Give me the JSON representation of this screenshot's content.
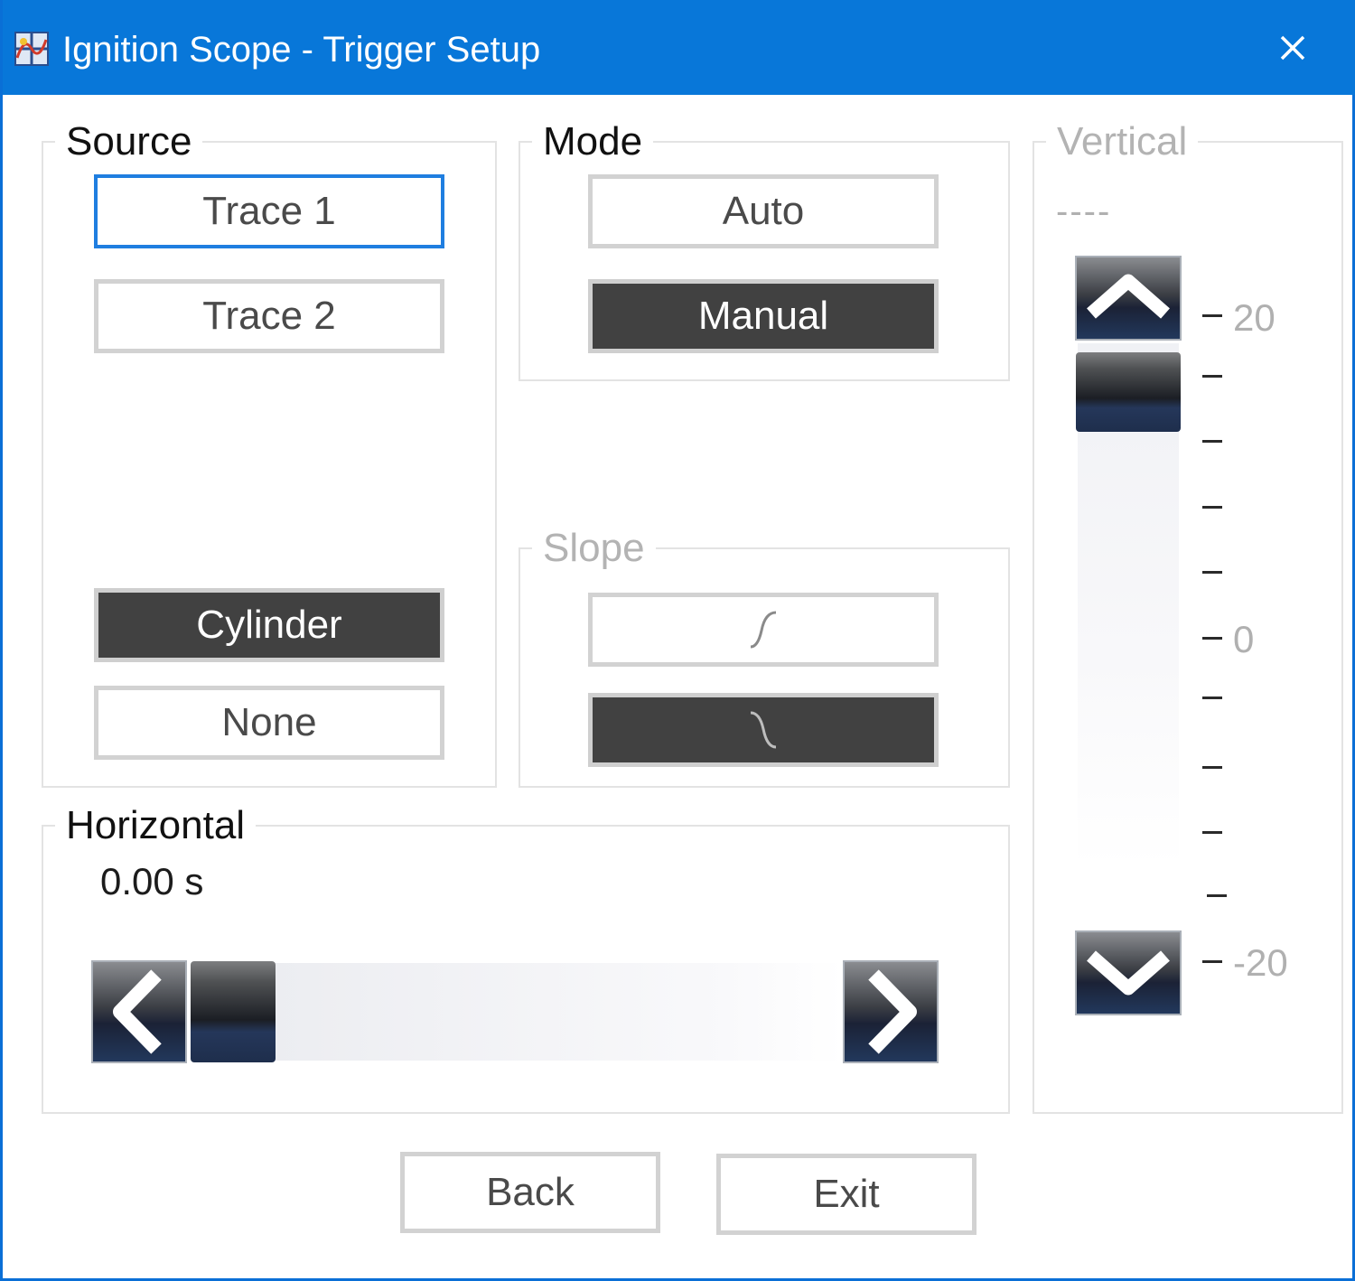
{
  "window": {
    "title": "Ignition Scope - Trigger Setup",
    "icon": "oscilloscope-app-icon",
    "close_icon": "close-icon",
    "accent_color": "#0877d9"
  },
  "source": {
    "label": "Source",
    "buttons": [
      {
        "label": "Trace 1",
        "selected": false,
        "focused": true
      },
      {
        "label": "Trace 2",
        "selected": false
      },
      {
        "label": "Cylinder",
        "selected": true
      },
      {
        "label": "None",
        "selected": false
      }
    ]
  },
  "mode": {
    "label": "Mode",
    "buttons": [
      {
        "label": "Auto",
        "selected": false
      },
      {
        "label": "Manual",
        "selected": true
      }
    ]
  },
  "slope": {
    "label": "Slope",
    "enabled": false,
    "buttons": [
      {
        "icon": "rising-slope-icon",
        "selected": false
      },
      {
        "icon": "falling-slope-icon",
        "selected": true
      }
    ]
  },
  "vertical": {
    "label": "Vertical",
    "enabled": false,
    "value": "----",
    "scale_max": 20,
    "scale_min": -20,
    "labels": {
      "top": "20",
      "middle": "0",
      "bottom": "-20"
    },
    "up_icon": "chevron-up-icon",
    "down_icon": "chevron-down-icon"
  },
  "horizontal": {
    "label": "Horizontal",
    "value": "0.00 s",
    "left_icon": "chevron-left-icon",
    "right_icon": "chevron-right-icon"
  },
  "footer": {
    "back_label": "Back",
    "exit_label": "Exit"
  }
}
